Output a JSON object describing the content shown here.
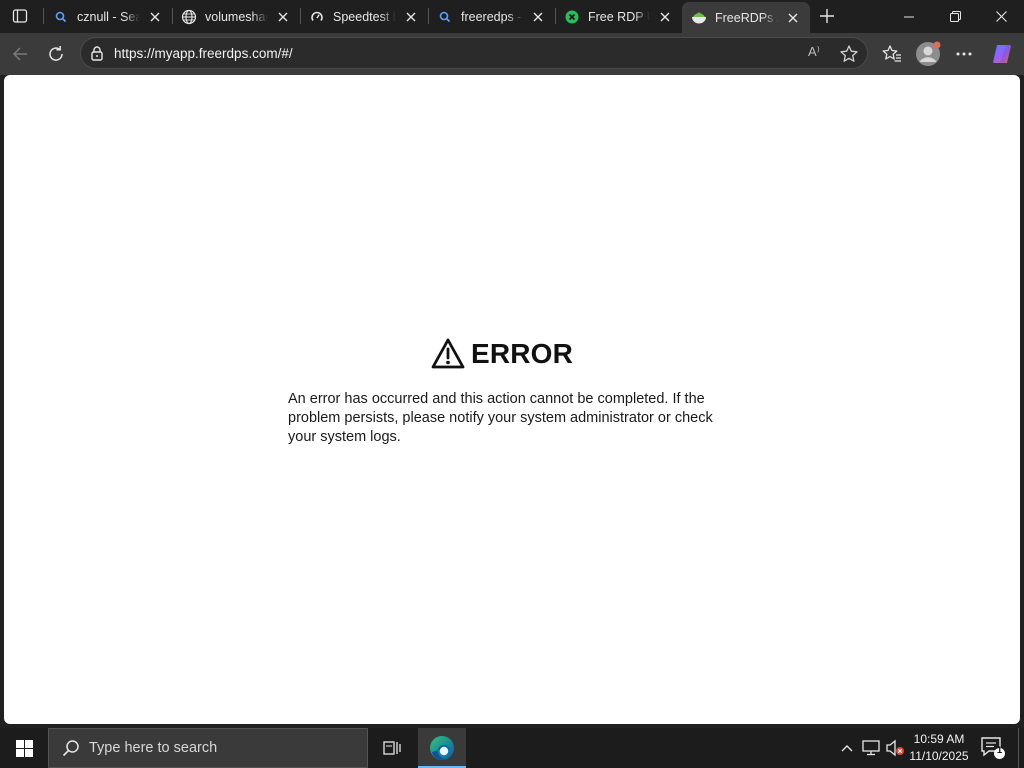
{
  "browser": {
    "tabs": [
      {
        "title": "cznull - Sear",
        "icon": "search-icon",
        "active": false
      },
      {
        "title": "volumeshadi",
        "icon": "globe-icon",
        "active": false
      },
      {
        "title": "Speedtest by",
        "icon": "speedtest-icon",
        "active": false
      },
      {
        "title": "freeredps - S",
        "icon": "search-icon",
        "active": false
      },
      {
        "title": "Free RDP Us",
        "icon": "freerdp-icon",
        "active": false
      },
      {
        "title": "FreeRDPs AI",
        "icon": "bowl-icon",
        "active": true
      }
    ],
    "url": "https://myapp.freerdps.com/#/",
    "read_aloud_label": "A⁾"
  },
  "page": {
    "error_title": "ERROR",
    "error_message": "An error has occurred and this action cannot be completed. If the problem persists, please notify your system administrator or check your system logs."
  },
  "taskbar": {
    "search_placeholder": "Type here to search",
    "time": "10:59 AM",
    "date": "11/10/2025",
    "notification_count": "1"
  },
  "colors": {
    "accent": "#6fb8f3",
    "tab_active": "#3b3b3b",
    "page_bg": "#ffffff"
  }
}
